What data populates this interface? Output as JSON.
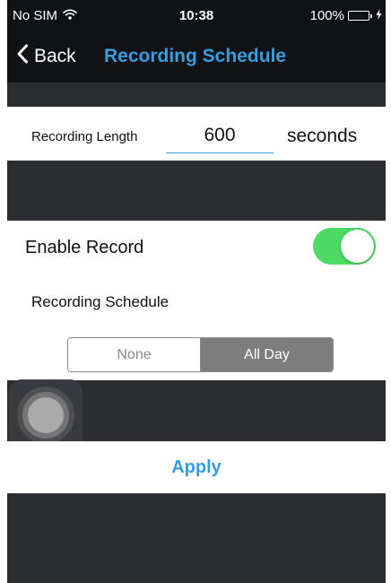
{
  "status_bar": {
    "carrier": "No SIM",
    "wifi_icon": "wifi-icon",
    "time": "10:38",
    "battery_percent": "100%",
    "battery_level": 1.0,
    "charging_icon": "bolt-icon"
  },
  "nav": {
    "back_label": "Back",
    "title": "Recording Schedule"
  },
  "recording_length": {
    "label": "Recording Length",
    "value": "600",
    "unit": "seconds"
  },
  "enable_record": {
    "label": "Enable Record",
    "enabled": true
  },
  "schedule": {
    "label": "Recording Schedule",
    "options": [
      "None",
      "All Day"
    ],
    "selected": "All Day"
  },
  "apply_label": "Apply",
  "colors": {
    "accent": "#3a9ce0",
    "toggle_on": "#4cd964",
    "nav_background": "#111214",
    "section_background": "#2b2d31",
    "segment_selected": "#7d7d7d"
  }
}
